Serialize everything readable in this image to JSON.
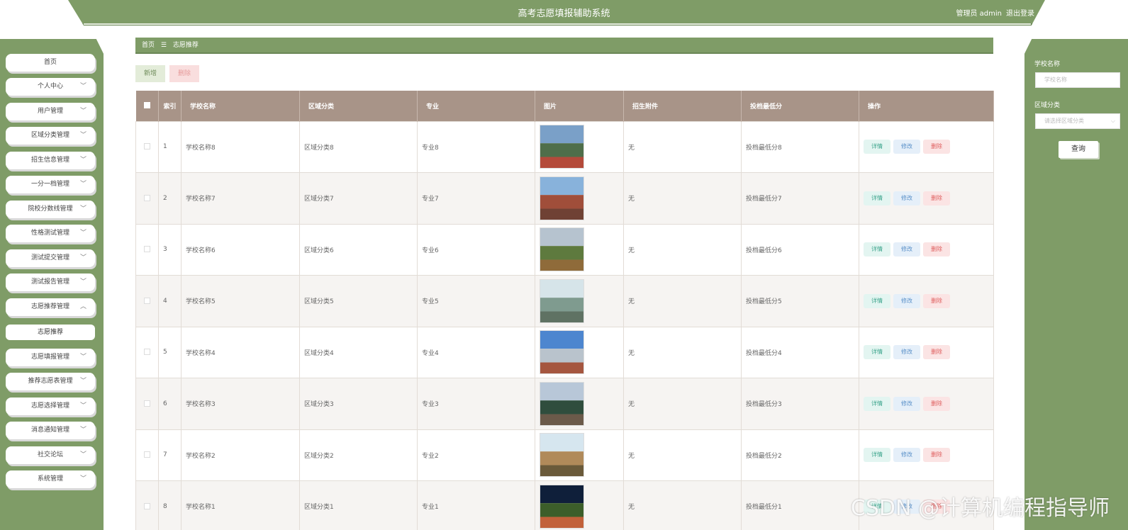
{
  "header": {
    "title": "高考志愿填报辅助系统",
    "user": "管理员 admin",
    "logout": "退出登录"
  },
  "sidebar": {
    "items": [
      {
        "label": "首页",
        "has_chevron": false
      },
      {
        "label": "个人中心",
        "has_chevron": true
      },
      {
        "label": "用户管理",
        "has_chevron": true
      },
      {
        "label": "区域分类管理",
        "has_chevron": true
      },
      {
        "label": "招生信息管理",
        "has_chevron": true
      },
      {
        "label": "一分一档管理",
        "has_chevron": true
      },
      {
        "label": "院校分数线管理",
        "has_chevron": true
      },
      {
        "label": "性格测试管理",
        "has_chevron": true
      },
      {
        "label": "测试提交管理",
        "has_chevron": true
      },
      {
        "label": "测试报告管理",
        "has_chevron": true
      },
      {
        "label": "志愿推荐管理",
        "has_chevron": true,
        "expanded": true
      },
      {
        "label": "志愿填报管理",
        "has_chevron": true
      },
      {
        "label": "推荐志愿表管理",
        "has_chevron": true
      },
      {
        "label": "志愿选择管理",
        "has_chevron": true
      },
      {
        "label": "消息通知管理",
        "has_chevron": true
      },
      {
        "label": "社交论坛",
        "has_chevron": true
      },
      {
        "label": "系统管理",
        "has_chevron": true
      }
    ],
    "sub_item": "志愿推荐"
  },
  "breadcrumb": {
    "home": "首页",
    "sep": "☰",
    "current": "志愿推荐"
  },
  "toolbar": {
    "add": "新增",
    "delete": "删除"
  },
  "table": {
    "headers": [
      "索引",
      "学校名称",
      "区域分类",
      "专业",
      "图片",
      "招生附件",
      "投档最低分",
      "操作"
    ],
    "actions": {
      "detail": "详情",
      "edit": "修改",
      "delete": "删除"
    },
    "rows": [
      {
        "index": "1",
        "school": "学校名称8",
        "region": "区域分类8",
        "major": "专业8",
        "attachment": "无",
        "min_score": "投档最低分8",
        "image": "stadium-photo"
      },
      {
        "index": "2",
        "school": "学校名称7",
        "region": "区域分类7",
        "major": "专业7",
        "attachment": "无",
        "min_score": "投档最低分7",
        "image": "red-building-photo"
      },
      {
        "index": "3",
        "school": "学校名称6",
        "region": "区域分类6",
        "major": "专业6",
        "attachment": "无",
        "min_score": "投档最低分6",
        "image": "garden-photo"
      },
      {
        "index": "4",
        "school": "学校名称5",
        "region": "区域分类5",
        "major": "专业5",
        "attachment": "无",
        "min_score": "投档最低分5",
        "image": "gate-photo"
      },
      {
        "index": "5",
        "school": "学校名称4",
        "region": "区域分类4",
        "major": "专业4",
        "attachment": "无",
        "min_score": "投档最低分4",
        "image": "plaza-photo"
      },
      {
        "index": "6",
        "school": "学校名称3",
        "region": "区域分类3",
        "major": "专业3",
        "attachment": "无",
        "min_score": "投档最低分3",
        "image": "campus-building-photo"
      },
      {
        "index": "7",
        "school": "学校名称2",
        "region": "区域分类2",
        "major": "专业2",
        "attachment": "无",
        "min_score": "投档最低分2",
        "image": "classic-building-photo"
      },
      {
        "index": "8",
        "school": "学校名称1",
        "region": "区域分类1",
        "major": "专业1",
        "attachment": "无",
        "min_score": "投档最低分1",
        "image": "field-night-photo"
      }
    ]
  },
  "search": {
    "school_label": "学校名称",
    "school_placeholder": "学校名称",
    "region_label": "区域分类",
    "region_placeholder": "请选择区域分类",
    "button": "查询"
  },
  "watermark": "CSDN @计算机编程指导师",
  "colors": {
    "primary": "#7f9c67",
    "table_header": "#a89488"
  }
}
